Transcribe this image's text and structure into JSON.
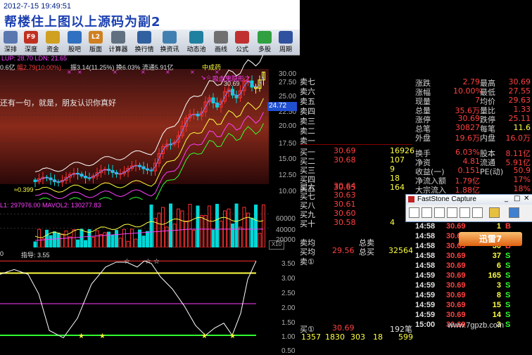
{
  "banner": {
    "date": "2012-7-15 19:49:51",
    "title": "帮楼住上图以上源码为副2"
  },
  "toolbar": {
    "items": [
      {
        "label": "深排",
        "icon": "sort-icon",
        "color": "#5a78b0"
      },
      {
        "label": "深度",
        "icon": "f9-key-icon",
        "key": "F9",
        "color": "#c03020"
      },
      {
        "label": "资金",
        "icon": "money-icon",
        "color": "#d0a020"
      },
      {
        "label": "股吧",
        "icon": "forum-icon",
        "color": "#3070c0"
      },
      {
        "label": "版面",
        "icon": "l2-icon",
        "key": "L2",
        "color": "#d08020"
      },
      {
        "label": "计算器",
        "icon": "calculator-icon",
        "color": "#607080"
      },
      {
        "label": "换行情",
        "icon": "switch-quote-icon",
        "color": "#3060a0"
      },
      {
        "label": "换资讯",
        "icon": "switch-news-icon",
        "color": "#4080b0"
      },
      {
        "label": "动态池",
        "icon": "pool-icon",
        "color": "#2080a0"
      },
      {
        "label": "画线",
        "icon": "draw-line-icon",
        "color": "#707070"
      },
      {
        "label": "公式",
        "icon": "formula-icon",
        "color": "#c03030"
      },
      {
        "label": "多股",
        "icon": "multi-stock-icon",
        "color": "#30a040"
      },
      {
        "label": "周期",
        "icon": "period-icon",
        "color": "#3050a0"
      }
    ]
  },
  "main_chart": {
    "line1": "LUP: 28.70  LDN: 21.65",
    "line2_a": "0.6亿",
    "line2_b": "幅2.79(10.00%)",
    "line2_c": "振3.14(11.25%)  换6.03%  流通5.91亿",
    "line2_d": "中成药",
    "overlay_text": "还有一句，就是，朋友认识你真好",
    "tag_text": "吸血鬼隐形之",
    "price_high": "30.69",
    "price_low": "≈0.399",
    "cursor_price": "24.72",
    "arrow_text": "↘☆"
  },
  "volume": {
    "header": "L1: 297976.00  MAVOL2: 130277.83",
    "axis_x10": "X10"
  },
  "indicator": {
    "header_prefix": "0",
    "name": "指导: 3.55"
  },
  "axis": {
    "main": [
      "30.00",
      "27.50",
      "25.00",
      "22.50",
      "20.00",
      "17.50",
      "15.00",
      "12.50",
      "10.00"
    ],
    "vol": [
      "60000",
      "40000",
      "20000"
    ],
    "idx": [
      "3.50",
      "3.00",
      "2.50",
      "2.00",
      "1.50",
      "1.00",
      "0.50"
    ]
  },
  "colors": {
    "up": "#ff3030",
    "down": "#00d8d8",
    "yellow": "#ffff40",
    "white": "#ffffff",
    "magenta": "#ff40ff",
    "green": "#30ff30",
    "gray": "#c0c0c0"
  },
  "book": {
    "sells": [
      {
        "label": "卖七",
        "price": "",
        "vol": ""
      },
      {
        "label": "卖六",
        "price": "",
        "vol": ""
      },
      {
        "label": "卖五",
        "price": "",
        "vol": ""
      },
      {
        "label": "卖四",
        "price": "",
        "vol": ""
      },
      {
        "label": "卖三",
        "price": "",
        "vol": ""
      },
      {
        "label": "卖二",
        "price": "",
        "vol": ""
      },
      {
        "label": "卖一",
        "price": "",
        "vol": ""
      }
    ],
    "buys": [
      {
        "label": "买一",
        "price": "30.69",
        "vol": "16926"
      },
      {
        "label": "买二",
        "price": "30.68",
        "vol": "107"
      },
      {
        "label": "买三",
        "price": "",
        "vol": "9"
      },
      {
        "label": "买四",
        "price": "",
        "vol": "18"
      },
      {
        "label": "买五",
        "price": "30.65",
        "vol": "164"
      },
      {
        "label": "买六",
        "price": "30.64",
        "vol": ""
      },
      {
        "label": "买七",
        "price": "30.63",
        "vol": ""
      },
      {
        "label": "买八",
        "price": "30.61",
        "vol": ""
      },
      {
        "label": "买九",
        "price": "30.60",
        "vol": ""
      },
      {
        "label": "买十",
        "price": "30.58",
        "vol": "4"
      }
    ],
    "avg_label1": "卖均",
    "avg_label2": "买均",
    "avg_buy_price": "29.56",
    "total_sell_label": "总卖",
    "total_buy_label": "总买",
    "total_buy": "32564",
    "sell_ind": "卖①",
    "buy_ind": "买①",
    "buy_ind_price": "30.69",
    "buy_ind_vol": "192笔",
    "bottom_nums": [
      "1357",
      "1830",
      "303",
      "18",
      "599"
    ]
  },
  "quote": [
    {
      "l1": "涨跌",
      "v1": "2.79",
      "l2": "最高",
      "v2": "30.69"
    },
    {
      "l1": "涨幅",
      "v1": "10.00%",
      "l2": "最低",
      "v2": "27.55"
    },
    {
      "l1": "现量",
      "v1": "7",
      "l2": "均价",
      "v2": "29.63"
    },
    {
      "l1": "总量",
      "v1": "35.6万",
      "l2": "量比",
      "v2": "1.33"
    },
    {
      "l1": "涨停",
      "v1": "30.69",
      "l2": "跌停",
      "v2": "25.11"
    },
    {
      "l1": "总笔",
      "v1": "30827",
      "l2": "每笔",
      "v2": "11.6"
    },
    {
      "l1": "外盘",
      "v1": "19.6万",
      "l2": "内盘",
      "v2": "16.0万"
    },
    {
      "l1": "换手",
      "v1": "6.03%",
      "l2": "股本",
      "v2": "8.11亿"
    },
    {
      "l1": "净资",
      "v1": "4.81",
      "l2": "流通",
      "v2": "5.91亿"
    },
    {
      "l1": "收益(一)",
      "v1": "0.151",
      "l2": "PE(动)",
      "v2": "50.9"
    },
    {
      "l1": "净流入额",
      "v1": "1.79亿",
      "l2": "",
      "v2": "17%"
    },
    {
      "l1": "大宗流入",
      "v1": "1.88亿",
      "l2": "",
      "v2": "18%"
    }
  ],
  "faststone": {
    "title": "FastStone Capture",
    "min": "_",
    "max": "□",
    "close": "✕"
  },
  "ticks": [
    {
      "time": "14:58",
      "price": "30.69",
      "vol": "1",
      "dir": "B"
    },
    {
      "time": "14:58",
      "price": "30.69",
      "vol": "28",
      "dir": "S"
    },
    {
      "time": "14:58",
      "price": "30.69",
      "vol": "30",
      "dir": "B"
    },
    {
      "time": "14:58",
      "price": "30.69",
      "vol": "37",
      "dir": "S"
    },
    {
      "time": "14:58",
      "price": "30.69",
      "vol": "6",
      "dir": "S"
    },
    {
      "time": "14:59",
      "price": "30.69",
      "vol": "165",
      "dir": "S"
    },
    {
      "time": "14:59",
      "price": "30.69",
      "vol": "3",
      "dir": "S"
    },
    {
      "time": "14:59",
      "price": "30.69",
      "vol": "8",
      "dir": "S"
    },
    {
      "time": "14:59",
      "price": "30.69",
      "vol": "15",
      "dir": "S"
    },
    {
      "time": "14:59",
      "price": "30.69",
      "vol": "14",
      "dir": "S"
    },
    {
      "time": "15:00",
      "price": "30.69",
      "vol": "3",
      "dir": "S"
    }
  ],
  "xunlei": "迅雷7",
  "watermark": "www.7gpzb.com"
}
